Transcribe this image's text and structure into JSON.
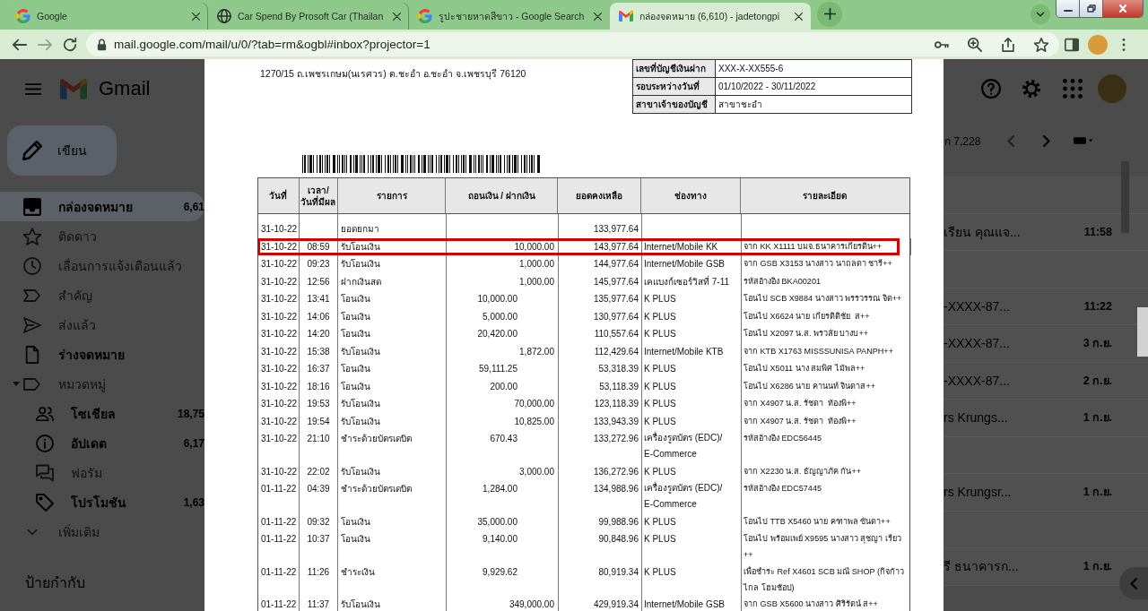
{
  "browser": {
    "tabs": [
      {
        "kind": "google",
        "title": "Google",
        "selected": false
      },
      {
        "kind": "globe",
        "title": "Car Spend By Prosoft Car (Thailan",
        "selected": false
      },
      {
        "kind": "google",
        "title": "รูปะชายหาดสีขาว - Google Search",
        "selected": false
      },
      {
        "kind": "gmail",
        "title": "กล่องจดหมาย (6,610) - jadetongpi",
        "selected": true
      }
    ],
    "address_bar": {
      "url": "mail.google.com/mail/u/0/?tab=rm&ogbl#inbox?projector=1"
    }
  },
  "gmail": {
    "logo_text": "Gmail",
    "compose_button": "เขียน",
    "nav": [
      {
        "kind": "inbox",
        "label": "กล่องจดหมาย",
        "count": "6,61",
        "selected": true,
        "unread": true
      },
      {
        "kind": "starred",
        "label": "ติดดาว",
        "selected": false,
        "unread": false
      },
      {
        "kind": "snoozed",
        "label": "เลื่อนการแจ้งเตือนแล้ว",
        "selected": false,
        "unread": false
      },
      {
        "kind": "important",
        "label": "สำคัญ",
        "selected": false,
        "unread": false
      },
      {
        "kind": "sent",
        "label": "ส่งแล้ว",
        "selected": false,
        "unread": false
      },
      {
        "kind": "drafts",
        "label": "ร่างจดหมาย",
        "selected": false,
        "unread": true
      },
      {
        "kind": "categories",
        "label": "หมวดหมู่",
        "selected": false,
        "unread": false,
        "expanded": true,
        "children": [
          {
            "kind": "social",
            "label": "โซเชียล",
            "count": "18,75",
            "selected": false,
            "unread": true
          },
          {
            "kind": "updates",
            "label": "อัปเดต",
            "count": "6,17",
            "selected": false,
            "unread": true
          },
          {
            "kind": "forums",
            "label": "ฟอรัม",
            "selected": false,
            "unread": false
          },
          {
            "kind": "promotions",
            "label": "โปรโมชัน",
            "count": "1,63",
            "selected": false,
            "unread": true
          }
        ]
      },
      {
        "kind": "more",
        "label": "เพิ่มเติม",
        "selected": false,
        "unread": false
      }
    ],
    "labels_heading": "ป้ายกำกับ",
    "pagination": "ก 7,228",
    "messages": [
      {
        "snippet": "เรียน คุณแจ...",
        "time": "11:58",
        "unread": true
      },
      {
        "snippet": "-XXXX-87...",
        "time": "11:22",
        "unread": true
      },
      {
        "snippet": "-XXXX-87...",
        "time": "3 ก.ย.",
        "unread": true
      },
      {
        "snippet": "-XXXX-87...",
        "time": "2 ก.ย.",
        "unread": true
      },
      {
        "snippet": "rs Krungs...",
        "time": "1 ก.ย.",
        "unread": true
      },
      {
        "snippet": "rs Krungsr...",
        "time": "1 ก.ย.",
        "unread": true
      },
      {
        "snippet": "รี ธนาคารก...",
        "time": "1 ก.ย.",
        "unread": true
      }
    ]
  },
  "statement": {
    "address": "1270/15 ถ.เพชรเกษม(นเรศวร) ต.ชะอำ อ.ชะอำ จ.เพชรบุรี 76120",
    "account_info": [
      {
        "label": "เลขที่บัญชีเงินฝาก",
        "value": "XXX-X-XX555-6"
      },
      {
        "label": "รอบระหว่างวันที่",
        "value": "01/10/2022 - 30/11/2022"
      },
      {
        "label": "สาขาเจ้าของบัญชี",
        "value": "สาขาชะอำ"
      }
    ],
    "table": {
      "columns": [
        "วันที่",
        "เวลา/\nวันที่มีผล",
        "รายการ",
        "ถอนเงิน / ฝากเงิน",
        "ยอดคงเหลือ",
        "ช่องทาง",
        "รายละเอียด"
      ],
      "rows": [
        {
          "date": "31-10-22",
          "description": "ยอดยกมา",
          "balance": "133,977.64",
          "highlighted": false
        },
        {
          "date": "31-10-22",
          "time": "08:59",
          "description": "รับโอนเงิน",
          "deposit": "10,000.00",
          "balance": "143,977.64",
          "channel": "Internet/Mobile KK",
          "details": "จาก KK X1111 บมจ.ธนาคารเกียรติน++",
          "highlighted": true
        },
        {
          "date": "31-10-22",
          "time": "09:23",
          "description": "รับโอนเงิน",
          "deposit": "1,000.00",
          "balance": "144,977.64",
          "channel": "Internet/Mobile GSB",
          "details": "จาก GSB X3153 นางสาว นาถลดา ชารี++",
          "highlighted": false
        },
        {
          "date": "31-10-22",
          "time": "12:56",
          "description": "ฝากเงินสด",
          "deposit": "1,000.00",
          "balance": "145,977.64",
          "channel": "เคแบงก์เซอร์วิสที่ 7-11",
          "details": "รหัสอ้างอิง BKA00201",
          "highlighted": false
        },
        {
          "date": "31-10-22",
          "time": "13:41",
          "description": "โอนเงิน",
          "withdrawal": "10,000.00",
          "balance": "135,977.64",
          "channel": "K PLUS",
          "details": "โอนไป SCB X9884 นางสาว พรรวรรณ จิต++",
          "highlighted": false
        },
        {
          "date": "31-10-22",
          "time": "14:06",
          "description": "โอนเงิน",
          "withdrawal": "5,000.00",
          "balance": "130,977.64",
          "channel": "K PLUS",
          "details": "โอนไป X6624 นาย เกียรติติชัย  ส++",
          "highlighted": false
        },
        {
          "date": "31-10-22",
          "time": "14:20",
          "description": "โอนเงิน",
          "withdrawal": "20,420.00",
          "balance": "110,557.64",
          "channel": "K PLUS",
          "details": "โอนไป X2097 น.ส. พรวลัย บางบ++",
          "highlighted": false
        },
        {
          "date": "31-10-22",
          "time": "15:38",
          "description": "รับโอนเงิน",
          "deposit": "1,872.00",
          "balance": "112,429.64",
          "channel": "Internet/Mobile KTB",
          "details": "จาก KTB X1763 MISSSUNISA PANPH++",
          "highlighted": false
        },
        {
          "date": "31-10-22",
          "time": "16:37",
          "description": "โอนเงิน",
          "withdrawal": "59,111.25",
          "balance": "53,318.39",
          "channel": "K PLUS",
          "details": "โอนไป X5011 นาง สมพิศ ไม้พล++",
          "highlighted": false
        },
        {
          "date": "31-10-22",
          "time": "18:16",
          "description": "โอนเงิน",
          "withdrawal": "200.00",
          "balance": "53,118.39",
          "channel": "K PLUS",
          "details": "โอนไป X6286 นาย คานนท์ จินดาส++",
          "highlighted": false
        },
        {
          "date": "31-10-22",
          "time": "19:53",
          "description": "รับโอนเงิน",
          "deposit": "70,000.00",
          "balance": "123,118.39",
          "channel": "K PLUS",
          "details": "จาก X4907 น.ส. รัชดา  ท้องพิ++",
          "highlighted": false
        },
        {
          "date": "31-10-22",
          "time": "19:54",
          "description": "รับโอนเงิน",
          "deposit": "10,825.00",
          "balance": "133,943.39",
          "channel": "K PLUS",
          "details": "จาก X4907 น.ส. รัชดา  ท้องพิ++",
          "highlighted": false
        },
        {
          "date": "31-10-22",
          "time": "21:10",
          "description": "ชำระด้วยบัตรเดบิต",
          "withdrawal": "670.43",
          "balance": "133,272.96",
          "channel": "เครื่องรูดบัตร (EDC)/\nE-Commerce",
          "details": "รหัสอ้างอิง EDC56445",
          "highlighted": false
        },
        {
          "date": "31-10-22",
          "time": "22:02",
          "description": "รับโอนเงิน",
          "deposit": "3,000.00",
          "balance": "136,272.96",
          "channel": "K PLUS",
          "details": "จาก X2230 น.ส. ธัญญาภัค กัน++",
          "highlighted": false
        },
        {
          "date": "01-11-22",
          "time": "04:39",
          "description": "ชำระด้วยบัตรเดบิต",
          "withdrawal": "1,284.00",
          "balance": "134,988.96",
          "channel": "เครื่องรูดบัตร (EDC)/\nE-Commerce",
          "details": "รหัสอ้างอิง EDC57445",
          "highlighted": false
        },
        {
          "date": "01-11-22",
          "time": "09:32",
          "description": "โอนเงิน",
          "withdrawal": "35,000.00",
          "balance": "99,988.96",
          "channel": "K PLUS",
          "details": "โอนไป TTB X5460 นาย คฑาพล ขันดา++",
          "highlighted": false
        },
        {
          "date": "01-11-22",
          "time": "10:37",
          "description": "โอนเงิน",
          "withdrawal": "9,140.00",
          "balance": "90,848.96",
          "channel": "K PLUS",
          "details": "โอนไป พร้อมเพย์ X9595 นางสาว สุชญา เรียว\n++",
          "highlighted": false
        },
        {
          "date": "01-11-22",
          "time": "11:26",
          "description": "ชำระเงิน",
          "withdrawal": "9,929.62",
          "balance": "80,919.34",
          "channel": "K PLUS",
          "details": "เพื่อชำระ Ref X4601 SCB มณี SHOP (กิจก้าว\nไกล โฮมช้อป)",
          "highlighted": false
        },
        {
          "date": "01-11-22",
          "time": "11:37",
          "description": "รับโอนเงิน",
          "deposit": "349,000.00",
          "balance": "429,919.34",
          "channel": "Internet/Mobile GSB",
          "details": "จาก GSB X5600 นางสาว ศิริรัตน์ ส++",
          "highlighted": false
        }
      ]
    }
  }
}
